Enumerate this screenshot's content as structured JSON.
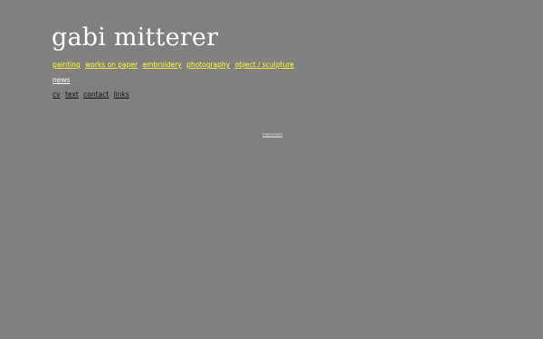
{
  "site": {
    "title": "gabi mitterer"
  },
  "nav_media": [
    "painting",
    "works on paper",
    "embroidery",
    "photography",
    "object / sculpture"
  ],
  "nav_news": [
    "news"
  ],
  "nav_info": [
    "cv",
    "text",
    "contact",
    "links"
  ],
  "footer": {
    "imprint_label": "impressum"
  },
  "colors": {
    "background": "#808080",
    "title": "#ffffff",
    "media_links": "#ffff33",
    "news_link": "#ffffff",
    "info_links": "#111111"
  }
}
